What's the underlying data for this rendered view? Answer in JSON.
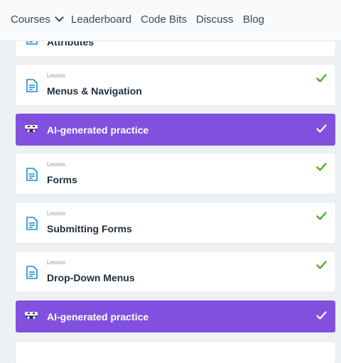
{
  "nav": {
    "courses": "Courses",
    "leaderboard": "Leaderboard",
    "code_bits": "Code Bits",
    "discuss": "Discuss",
    "blog": "Blog"
  },
  "items": [
    {
      "kind": "Lesson",
      "title": "Attributes"
    },
    {
      "kind": "Lesson",
      "title": "Menus & Navigation"
    },
    {
      "kind": "practice",
      "title": "AI-generated practice"
    },
    {
      "kind": "Lesson",
      "title": "Forms"
    },
    {
      "kind": "Lesson",
      "title": "Submitting Forms"
    },
    {
      "kind": "Lesson",
      "title": "Drop-Down Menus"
    },
    {
      "kind": "practice",
      "title": "AI-generated practice"
    }
  ],
  "colors": {
    "accent_purple": "#8150df",
    "check_green": "#4caf1e",
    "doc_blue": "#1a8cd8"
  },
  "icons": {
    "nav_dropdown": "chevron-down-icon",
    "lesson": "document-icon",
    "practice": "ai-mask-icon",
    "completed": "checkmark-icon"
  }
}
